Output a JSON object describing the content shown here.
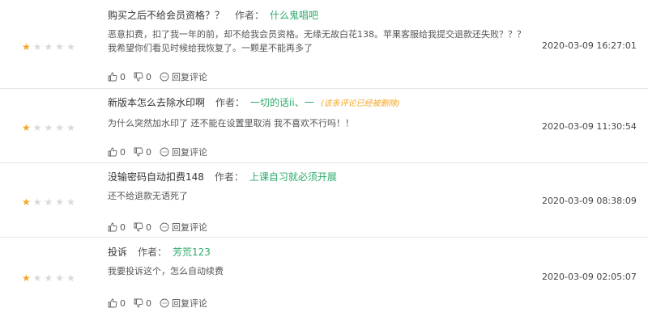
{
  "reviews": [
    {
      "title": "购买之后不给会员资格？？",
      "author_label": "作者：",
      "author": "什么鬼唱吧",
      "note": "",
      "text": "恶意扣费，扣了我一年的前，却不给我会员资格。无缘无故白花138。苹果客服给我提交退款还失败？？？我希望你们看见时候给我恢复了。一颗星不能再多了",
      "date": "2020-03-09 16:27:01",
      "rating": 1,
      "likes": "0",
      "dislikes": "0",
      "reply_label": "回复评论"
    },
    {
      "title": "新版本怎么去除水印啊",
      "author_label": "作者：",
      "author": "一切的话ii、一",
      "note": "(该条评论已经被删除)",
      "text": "为什么突然加水印了 还不能在设置里取消 我不喜欢不行吗！！",
      "date": "2020-03-09 11:30:54",
      "rating": 1,
      "likes": "0",
      "dislikes": "0",
      "reply_label": "回复评论"
    },
    {
      "title": "没输密码自动扣费148",
      "author_label": "作者：",
      "author": "上课自习就必须开展",
      "note": "",
      "text": "还不给退款无语死了",
      "date": "2020-03-09 08:38:09",
      "rating": 1,
      "likes": "0",
      "dislikes": "0",
      "reply_label": "回复评论"
    },
    {
      "title": "投诉",
      "author_label": "作者：",
      "author": "芳荒123",
      "note": "",
      "text": "我要投诉这个，怎么自动续费",
      "date": "2020-03-09 02:05:07",
      "rating": 1,
      "likes": "0",
      "dislikes": "0",
      "reply_label": "回复评论"
    }
  ],
  "max_rating": 5,
  "colors": {
    "author": "#2bab6b",
    "star_on": "#f5a623",
    "star_off": "#d9d9d9"
  }
}
